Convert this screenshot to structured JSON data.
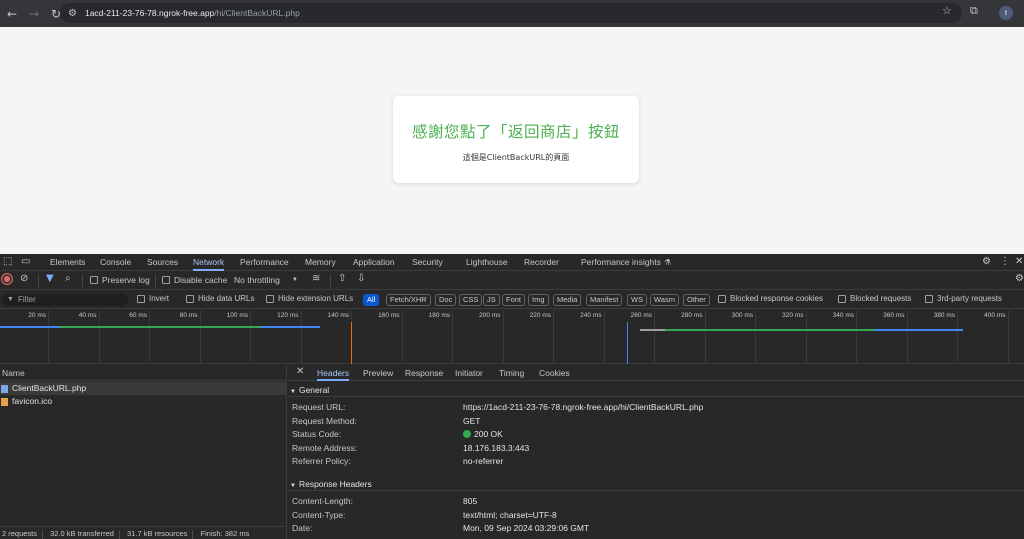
{
  "browser": {
    "url_host": "1acd-211-23-76-78.ngrok-free.app",
    "url_path": "/hi/ClientBackURL.php",
    "profile_initial": "t"
  },
  "page": {
    "heading": "感謝您點了「返回商店」按鈕",
    "subtext": "這個是ClientBackURL的頁面",
    "heading_color": "#4caf50"
  },
  "devtools": {
    "tabs": [
      "Elements",
      "Console",
      "Sources",
      "Network",
      "Performance",
      "Memory",
      "Application",
      "Security",
      "Lighthouse",
      "Recorder",
      "Performance insights"
    ],
    "active_tab": "Network",
    "toolbar": {
      "preserve_log": "Preserve log",
      "disable_cache": "Disable cache",
      "throttling": "No throttling"
    },
    "filter": {
      "placeholder": "Filter",
      "invert": "Invert",
      "hide_data_urls": "Hide data URLs",
      "hide_extension_urls": "Hide extension URLs",
      "types": [
        "All",
        "Fetch/XHR",
        "Doc",
        "CSS",
        "JS",
        "Font",
        "Img",
        "Media",
        "Manifest",
        "WS",
        "Wasm",
        "Other"
      ],
      "blocked_response_cookies": "Blocked response cookies",
      "blocked_requests": "Blocked requests",
      "third_party": "3rd-party requests"
    },
    "timeline_ticks": [
      "20 ms",
      "40 ms",
      "60 ms",
      "80 ms",
      "100 ms",
      "120 ms",
      "140 ms",
      "160 ms",
      "180 ms",
      "200 ms",
      "220 ms",
      "240 ms",
      "260 ms",
      "280 ms",
      "300 ms",
      "320 ms",
      "340 ms",
      "360 ms",
      "380 ms",
      "400 ms"
    ],
    "requests_header": "Name",
    "requests": [
      {
        "name": "ClientBackURL.php",
        "icon_color": "#7aa7e8"
      },
      {
        "name": "favicon.ico",
        "icon_color": "#e8a04a"
      }
    ],
    "summary": {
      "requests": "2 requests",
      "transferred": "32.0 kB transferred",
      "resources": "31.7 kB resources",
      "finish": "Finish: 382 ms"
    },
    "detail_tabs": [
      "Headers",
      "Preview",
      "Response",
      "Initiator",
      "Timing",
      "Cookies"
    ],
    "active_detail_tab": "Headers",
    "general": {
      "title": "General",
      "rows": [
        {
          "key": "Request URL:",
          "value": "https://1acd-211-23-76-78.ngrok-free.app/hi/ClientBackURL.php"
        },
        {
          "key": "Request Method:",
          "value": "GET"
        },
        {
          "key": "Status Code:",
          "value": "200 OK"
        },
        {
          "key": "Remote Address:",
          "value": "18.176.183.3:443"
        },
        {
          "key": "Referrer Policy:",
          "value": "no-referrer"
        }
      ]
    },
    "response_headers": {
      "title": "Response Headers",
      "rows": [
        {
          "key": "Content-Length:",
          "value": "805"
        },
        {
          "key": "Content-Type:",
          "value": "text/html; charset=UTF-8"
        },
        {
          "key": "Date:",
          "value": "Mon, 09 Sep 2024 03:29:06 GMT"
        }
      ]
    }
  }
}
